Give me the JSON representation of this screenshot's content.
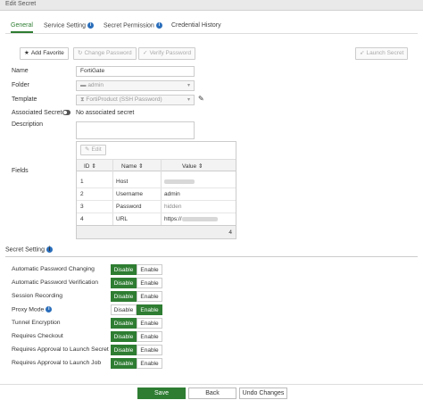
{
  "window": {
    "title": "Edit Secret"
  },
  "tabs": [
    {
      "label": "General",
      "active": true,
      "info": false
    },
    {
      "label": "Service Setting",
      "active": false,
      "info": true
    },
    {
      "label": "Secret Permission",
      "active": false,
      "info": true
    },
    {
      "label": "Credential History",
      "active": false,
      "info": false
    }
  ],
  "toolbar": {
    "add_favorite": "Add Favorite",
    "change_password": "Change Password",
    "verify_password": "Verify Password",
    "launch_secret": "Launch Secret"
  },
  "form": {
    "name_label": "Name",
    "name_value": "FortiGate",
    "folder_label": "Folder",
    "folder_value": "admin",
    "template_label": "Template",
    "template_value": "FortiProduct (SSH Password)",
    "associated_label": "Associated Secret",
    "associated_value": "No associated secret",
    "description_label": "Description",
    "fields_label": "Fields"
  },
  "fields_grid": {
    "edit_label": "Edit",
    "headers": [
      "ID",
      "Name",
      "Value"
    ],
    "rows": [
      {
        "id": "1",
        "name": "Host",
        "value": ""
      },
      {
        "id": "2",
        "name": "Username",
        "value": "admin"
      },
      {
        "id": "3",
        "name": "Password",
        "value": "hidden"
      },
      {
        "id": "4",
        "name": "URL",
        "value": "https://"
      }
    ],
    "count": "4"
  },
  "secret_setting": {
    "title": "Secret Setting",
    "rows": [
      {
        "label": "Automatic Password Changing",
        "enabled": false,
        "info": false
      },
      {
        "label": "Automatic Password Verification",
        "enabled": false,
        "info": false
      },
      {
        "label": "Session Recording",
        "enabled": false,
        "info": false
      },
      {
        "label": "Proxy Mode",
        "enabled": true,
        "info": true
      },
      {
        "label": "Tunnel Encryption",
        "enabled": false,
        "info": false
      },
      {
        "label": "Requires Checkout",
        "enabled": false,
        "info": false
      },
      {
        "label": "Requires Approval to Launch Secret",
        "enabled": false,
        "info": false
      },
      {
        "label": "Requires Approval to Launch Job",
        "enabled": false,
        "info": false
      }
    ],
    "disable_label": "Disable",
    "enable_label": "Enable"
  },
  "footer": {
    "save": "Save",
    "back": "Back",
    "undo": "Undo Changes"
  },
  "colors": {
    "accent": "#2e7d32",
    "info": "#2a6ebb"
  }
}
